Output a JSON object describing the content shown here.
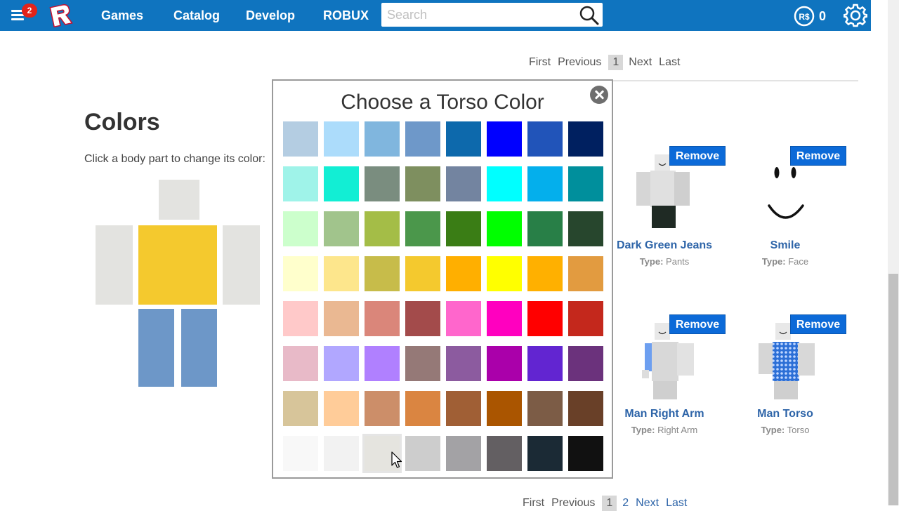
{
  "header": {
    "notification_count": "2",
    "nav": [
      {
        "label": "Games"
      },
      {
        "label": "Catalog"
      },
      {
        "label": "Develop"
      },
      {
        "label": "ROBUX"
      }
    ],
    "search_placeholder": "Search",
    "robux_label": "R$",
    "robux_balance": "0",
    "brand_color": "#0f74bf"
  },
  "pager_top": {
    "first": "First",
    "previous": "Previous",
    "current": "1",
    "next": "Next",
    "last": "Last"
  },
  "pager_bottom": {
    "first": "First",
    "previous": "Previous",
    "current": "1",
    "page2": "2",
    "next": "Next",
    "last": "Last"
  },
  "colors_panel": {
    "title": "Colors",
    "subtitle": "Click a body part to change its color:",
    "body_parts": {
      "head": "#e3e3e0",
      "torso": "#f4c92e",
      "left_arm": "#e3e3e0",
      "right_arm": "#e3e3e0",
      "left_leg": "#6d97c8",
      "right_leg": "#6d97c8"
    }
  },
  "modal": {
    "title": "Choose a Torso Color",
    "hovered_index": 58,
    "swatches": [
      "#b4cde2",
      "#acdcfb",
      "#80b6de",
      "#6e98c9",
      "#0d69ac",
      "#0000ff",
      "#2154b9",
      "#002060",
      "#9ff3e9",
      "#12eed4",
      "#7a8d7f",
      "#7e8f5f",
      "#7384a0",
      "#00ffff",
      "#04afec",
      "#008f9c",
      "#ccffcc",
      "#a1c48c",
      "#a4bd47",
      "#4b974b",
      "#3a7d15",
      "#00ff00",
      "#287f47",
      "#27462d",
      "#ffffcc",
      "#fde68c",
      "#c7bc4a",
      "#f4c92e",
      "#ffaf00",
      "#ffff00",
      "#ffb000",
      "#e29b40",
      "#ffc9c9",
      "#eab892",
      "#da867a",
      "#a34b4b",
      "#ff66cc",
      "#ff00bf",
      "#ff0000",
      "#c4281c",
      "#e8bac8",
      "#b1a7ff",
      "#b080ff",
      "#957977",
      "#8c5b9f",
      "#aa00aa",
      "#6225d1",
      "#6b327c",
      "#d7c59a",
      "#ffcc99",
      "#cc8e69",
      "#da8541",
      "#a05f35",
      "#aa5500",
      "#7c5c46",
      "#694028",
      "#f8f8f8",
      "#f2f2f2",
      "#e5e4df",
      "#cdcdcd",
      "#a3a2a5",
      "#635f62",
      "#1b2a35",
      "#111111"
    ]
  },
  "wearing": [
    {
      "name": "Dark Green Jeans",
      "type_label": "Type:",
      "type": "Pants",
      "action": "Remove",
      "thumb": "pants"
    },
    {
      "name": "Smile",
      "type_label": "Type:",
      "type": "Face",
      "action": "Remove",
      "thumb": "face"
    },
    {
      "name": "Man Right Arm",
      "type_label": "Type:",
      "type": "Right Arm",
      "action": "Remove",
      "thumb": "rightarm"
    },
    {
      "name": "Man Torso",
      "type_label": "Type:",
      "type": "Torso",
      "action": "Remove",
      "thumb": "torso"
    }
  ]
}
